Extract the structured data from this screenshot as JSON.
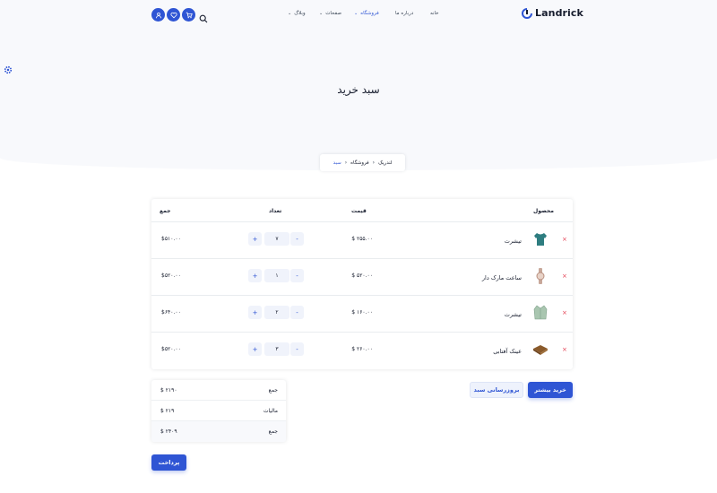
{
  "brand": {
    "name": "Landrick"
  },
  "nav": {
    "menu": [
      {
        "label": "خانه",
        "active": false,
        "dropdown": false
      },
      {
        "label": "درباره ما",
        "active": false,
        "dropdown": false
      },
      {
        "label": "فروشگاه",
        "active": true,
        "dropdown": true
      },
      {
        "label": "صفحات",
        "active": false,
        "dropdown": true
      },
      {
        "label": "وبلاگ",
        "active": false,
        "dropdown": true
      }
    ],
    "icons": [
      "user-icon",
      "heart-icon",
      "cart-icon",
      "search-icon"
    ]
  },
  "settings_icon": "gear-icon",
  "page": {
    "title": "سبد خرید"
  },
  "breadcrumb": [
    "لندریک",
    "فروشگاه",
    "سبد"
  ],
  "cart_table": {
    "headers": {
      "product": "محصول",
      "price": "قیمت",
      "quantity": "تعداد",
      "total": "جمع"
    },
    "remove_symbol": "×",
    "rows": [
      {
        "name": "تیشرت",
        "price": "$ ۲۵۵.۰۰",
        "qty": "۷",
        "total": "$۵۱۰.۰۰",
        "image": "tshirt-teal"
      },
      {
        "name": "ساعت مارک دار",
        "price": "$ ۵۲۰.۰۰",
        "qty": "۱",
        "total": "$۵۲۰.۰۰",
        "image": "watch"
      },
      {
        "name": "تیشرت",
        "price": "$ ۱۶۰.۰۰",
        "qty": "۲",
        "total": "$۶۴۰.۰۰",
        "image": "shirt-green"
      },
      {
        "name": "عینک آفتابی",
        "price": "$ ۲۶۰.۰۰",
        "qty": "۳",
        "total": "$۵۲۰.۰۰",
        "image": "wallet"
      }
    ],
    "minus": "-",
    "plus": "+"
  },
  "actions": {
    "shop_more": "خرید بیشتر",
    "update_cart": "بروزرسانی سبد"
  },
  "summary": {
    "rows": [
      {
        "label": "جمع",
        "value": "$ ۲۱۹۰"
      },
      {
        "label": "مالیات",
        "value": "$ ۲۱۹"
      },
      {
        "label": "جمع",
        "value": "$ ۲۴۰۹"
      }
    ]
  },
  "checkout": {
    "label": "پرداخت"
  },
  "colors": {
    "primary": "#2f55d4",
    "danger": "#e43f52",
    "hero_bg": "#f8f9fc"
  }
}
